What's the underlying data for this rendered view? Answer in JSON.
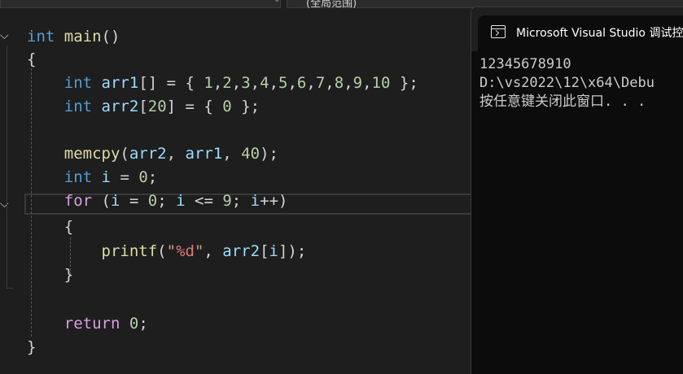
{
  "topbar": {
    "scope_label": "(全局范围)"
  },
  "code_lines": [
    [
      {
        "t": "int",
        "c": "kw"
      },
      {
        "t": " "
      },
      {
        "t": "main",
        "c": "fn"
      },
      {
        "t": "()"
      }
    ],
    [
      {
        "t": "{"
      }
    ],
    [
      {
        "t": "    "
      },
      {
        "t": "int",
        "c": "kw"
      },
      {
        "t": " "
      },
      {
        "t": "arr1",
        "c": "id"
      },
      {
        "t": "[] = { "
      },
      {
        "t": "1",
        "c": "num"
      },
      {
        "t": ","
      },
      {
        "t": "2",
        "c": "num"
      },
      {
        "t": ","
      },
      {
        "t": "3",
        "c": "num"
      },
      {
        "t": ","
      },
      {
        "t": "4",
        "c": "num"
      },
      {
        "t": ","
      },
      {
        "t": "5",
        "c": "num"
      },
      {
        "t": ","
      },
      {
        "t": "6",
        "c": "num"
      },
      {
        "t": ","
      },
      {
        "t": "7",
        "c": "num"
      },
      {
        "t": ","
      },
      {
        "t": "8",
        "c": "num"
      },
      {
        "t": ","
      },
      {
        "t": "9",
        "c": "num"
      },
      {
        "t": ","
      },
      {
        "t": "10",
        "c": "num"
      },
      {
        "t": " };"
      }
    ],
    [
      {
        "t": "    "
      },
      {
        "t": "int",
        "c": "kw"
      },
      {
        "t": " "
      },
      {
        "t": "arr2",
        "c": "id"
      },
      {
        "t": "["
      },
      {
        "t": "20",
        "c": "num"
      },
      {
        "t": "] = { "
      },
      {
        "t": "0",
        "c": "num"
      },
      {
        "t": " };"
      }
    ],
    [],
    [
      {
        "t": "    "
      },
      {
        "t": "memcpy",
        "c": "fn"
      },
      {
        "t": "("
      },
      {
        "t": "arr2",
        "c": "id"
      },
      {
        "t": ", "
      },
      {
        "t": "arr1",
        "c": "id"
      },
      {
        "t": ", "
      },
      {
        "t": "40",
        "c": "num"
      },
      {
        "t": ");"
      }
    ],
    [
      {
        "t": "    "
      },
      {
        "t": "int",
        "c": "kw"
      },
      {
        "t": " "
      },
      {
        "t": "i",
        "c": "id"
      },
      {
        "t": " = "
      },
      {
        "t": "0",
        "c": "num"
      },
      {
        "t": ";"
      }
    ],
    [
      {
        "t": "    "
      },
      {
        "t": "for",
        "c": "kw2"
      },
      {
        "t": " ("
      },
      {
        "t": "i",
        "c": "id"
      },
      {
        "t": " = "
      },
      {
        "t": "0",
        "c": "num"
      },
      {
        "t": "; "
      },
      {
        "t": "i",
        "c": "id"
      },
      {
        "t": " <= "
      },
      {
        "t": "9",
        "c": "num"
      },
      {
        "t": "; "
      },
      {
        "t": "i",
        "c": "id"
      },
      {
        "t": "++)"
      }
    ],
    [
      {
        "t": "    {"
      }
    ],
    [
      {
        "t": "        "
      },
      {
        "t": "printf",
        "c": "fn"
      },
      {
        "t": "("
      },
      {
        "t": "\"",
        "c": "str"
      },
      {
        "t": "%d",
        "c": "fmt"
      },
      {
        "t": "\"",
        "c": "str"
      },
      {
        "t": ", "
      },
      {
        "t": "arr2",
        "c": "id"
      },
      {
        "t": "["
      },
      {
        "t": "i",
        "c": "id"
      },
      {
        "t": "]);"
      }
    ],
    [
      {
        "t": "    }"
      }
    ],
    [],
    [
      {
        "t": "    "
      },
      {
        "t": "return",
        "c": "kw2"
      },
      {
        "t": " "
      },
      {
        "t": "0",
        "c": "num"
      },
      {
        "t": ";"
      }
    ],
    [
      {
        "t": "}"
      }
    ]
  ],
  "console": {
    "title": "Microsoft Visual Studio 调试控",
    "output": [
      "12345678910",
      "D:\\vs2022\\12\\x64\\Debu",
      "按任意键关闭此窗口. . ."
    ]
  },
  "icons": {
    "fold": "chevron-down-icon",
    "terminal": "terminal-icon"
  }
}
